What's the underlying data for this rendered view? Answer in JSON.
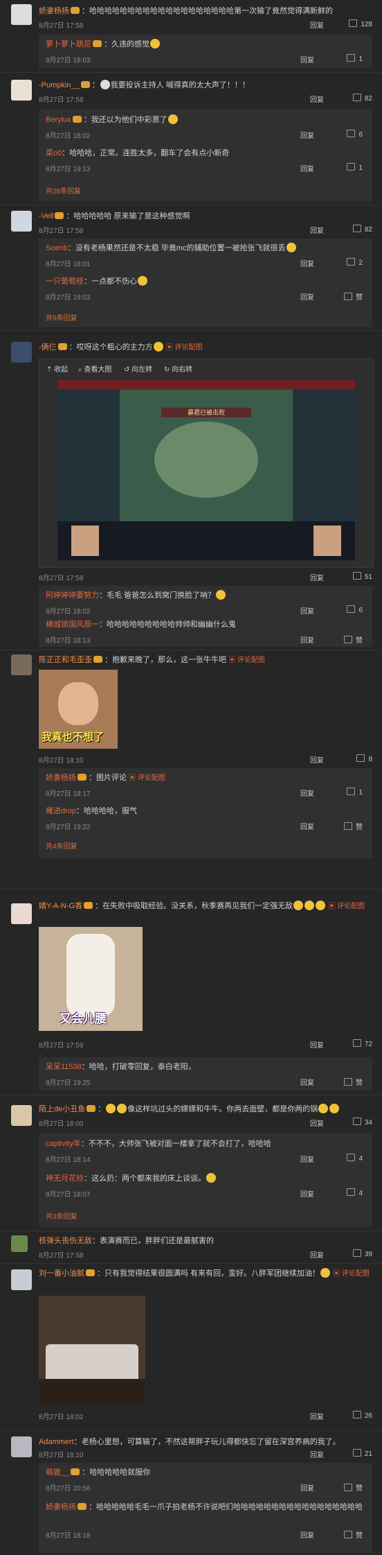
{
  "labels": {
    "reply": "回复",
    "zan": "赞",
    "pic_comment": "图片评论",
    "view_pic": "评论配图"
  },
  "viewer": {
    "collapse": "收起",
    "large": "查看大图",
    "left": "向左转",
    "right": "向右转",
    "scene_banner": "暴君已被击败"
  },
  "comments": [
    {
      "user": "娇妻杨扬",
      "text": "哈哈哈哈哈哈哈哈哈哈哈哈哈哈哈哈哈哈哈第一次输了竟然觉得满新鲜的",
      "time": "8月27日 17:58",
      "likes": "128",
      "replies": [
        {
          "user": "萝卜萝卜跳尼",
          "text": "久违的感觉",
          "time": "8月27日 18:03",
          "likes": "1"
        }
      ],
      "more": ""
    },
    {
      "user": "-Pumpkin__",
      "text": "我要投诉主持人 喊得真的太大声了！！！",
      "time": "8月27日 17:58",
      "likes": "82",
      "replies": [
        {
          "user": "Berylux",
          "text": "我还以为他们中彩票了",
          "time": "8月27日 18:02",
          "likes": "6"
        },
        {
          "user": "菜o0",
          "text": "哈哈哈，正常。连胜太多，翻车了会有点小新奇",
          "time": "8月27日 19:13",
          "likes": "1"
        }
      ],
      "more": "共28条回复"
    },
    {
      "user": "-Vell",
      "text": "哈哈哈哈哈 原来输了是这种感觉啊",
      "time": "8月27日 17:58",
      "likes": "82",
      "replies": [
        {
          "user": "Soenb",
          "text": "没有老杨果然还是不太稳 毕竟mc的辅助位置一被抢张飞就很丢",
          "time": "8月27日 18:01",
          "likes": "2"
        },
        {
          "user": "一只葡萄桂",
          "text": "一点都不伤心",
          "time": "8月27日 19:03",
          "likes": "赞"
        }
      ],
      "more": "共5条回复"
    },
    {
      "user": "-俩仨",
      "text": "哎呀这个粗心的主力方",
      "time": "8月27日 17:58",
      "likes": "51",
      "replies": [
        {
          "user": "阿婷婷婷要努力",
          "text": "毛毛 爸爸怎么到窝门换脸了呐？",
          "time": "8月27日 18:02",
          "likes": "6"
        },
        {
          "user": "横城锁国风原一",
          "text": "哈哈哈哈哈哈哈哈哈帅帅和幽幽什么鬼",
          "time": "8月27日 18:13",
          "likes": "赞"
        }
      ],
      "more": ""
    },
    {
      "user": "陈正正和毛歪歪",
      "text": "抱歉来晚了，那么，这一张牛牛吧",
      "time": "8月27日 18:10",
      "likes": "8",
      "image_caption": "我真也不想了",
      "replies": [
        {
          "user": "娇妻杨扬",
          "text": "",
          "time": "8月27日 18:17",
          "likes": "1"
        },
        {
          "user": "瘫进drop",
          "text": "哈哈哈哈，服气",
          "time": "8月27日 19:22",
          "likes": "赞"
        }
      ],
      "more": "共4条回复"
    },
    {
      "user": "婧Y-A-N-G香",
      "text": "在失败中吸取经验。没关系，秋季赛再见我们一定强无敌",
      "time": "8月27日 17:59",
      "likes": "72",
      "image_caption": "又会儿腰",
      "replies": [
        {
          "user": "呆呆11538",
          "text": "哈哈，打破零回复，泰白老阳，",
          "time": "8月27日 19:25",
          "likes": "赞"
        }
      ],
      "more": ""
    },
    {
      "user": "陌上de小丑鱼",
      "text": "像这样坑过头的嫖嫖和牛牛。你两去面壁，都是你两的锅",
      "time": "8月27日 18:00",
      "likes": "34",
      "replies": [
        {
          "user": "captivity年",
          "text": "不不不，大帅张飞被对面一楼拿了就不会打了，哈哈哈",
          "time": "8月27日 18:14",
          "likes": "4"
        },
        {
          "user": "神无月花铃",
          "text": "这么扔：两个都来我的床上谈谈。",
          "time": "8月27日 18:07",
          "likes": "4"
        }
      ],
      "more": "共3条回复"
    },
    {
      "user": "核弹头丧伤无敌",
      "text": "表演赛而已，胖胖们还是最腻害的",
      "time": "8月27日 17:58",
      "likes": "39",
      "replies": [],
      "more": ""
    },
    {
      "user": "刘一番小油腻",
      "text": "只有我觉得结果很圆满吗 有来有回，蛮好。八胖军团继续加油！",
      "time": "8月27日 18:02",
      "likes": "26",
      "replies": [],
      "more": ""
    },
    {
      "user": "Adammert",
      "text": "老杨心里想，可算输了，不然这帮胖子玩儿得都快忘了留在深宫养病的我了。",
      "time": "8月27日 18:10",
      "likes": "21",
      "replies": [
        {
          "user": "萌鹿__",
          "text": "哈哈哈哈哈就服你",
          "time": "8月27日 20:56",
          "likes": "赞"
        },
        {
          "user": "娇妻杨扬",
          "text": "哈哈哈哈哈毛毛一爪子拍老杨不许说吧们哈哈哈哈哈哈哈哈哈哈哈哈哈哈哈哈哈",
          "time": "8月27日 18:18",
          "likes": "赞"
        }
      ],
      "more": ""
    }
  ]
}
